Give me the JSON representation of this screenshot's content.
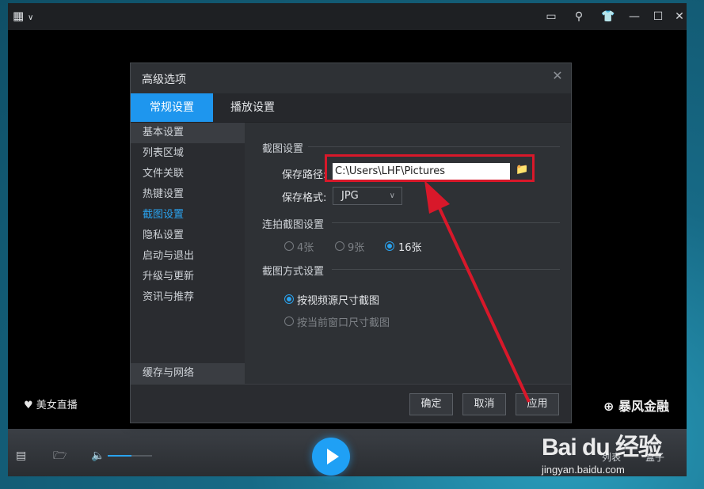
{
  "player": {
    "corner_left": "美女直播",
    "corner_right": "暴风金融",
    "list_label": "列表",
    "box_label": "盒子"
  },
  "dialog": {
    "title": "高级选项",
    "tabs": [
      "常规设置",
      "播放设置"
    ],
    "sidebar": [
      "基本设置",
      "列表区域",
      "文件关联",
      "热键设置",
      "截图设置",
      "隐私设置",
      "启动与退出",
      "升级与更新",
      "资讯与推荐"
    ],
    "sidebar_bottom": "缓存与网络",
    "screenshot_section": "截图设置",
    "save_path_label": "保存路径:",
    "save_path_value": "C:\\Users\\LHF\\Pictures",
    "save_format_label": "保存格式:",
    "save_format_value": "JPG",
    "burst_section": "连拍截图设置",
    "burst_options": [
      "4张",
      "9张",
      "16张"
    ],
    "method_section": "截图方式设置",
    "method_options": [
      "按视频源尺寸截图",
      "按当前窗口尺寸截图"
    ],
    "buttons": {
      "ok": "确定",
      "cancel": "取消",
      "apply": "应用"
    }
  },
  "watermark": {
    "logo": "Bai du 经验",
    "url": "jingyan.baidu.com"
  },
  "colors": {
    "accent": "#1e96ee",
    "highlight_red": "#d8182a"
  }
}
